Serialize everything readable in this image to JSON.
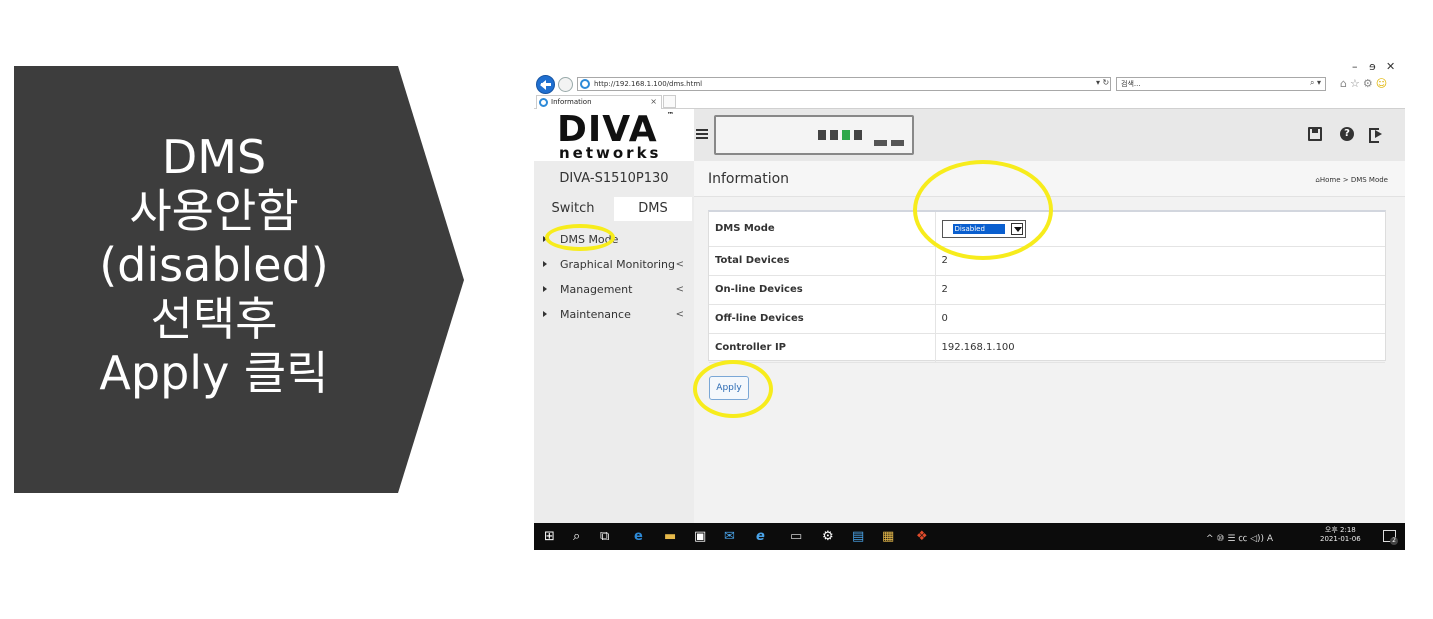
{
  "callout": {
    "lines": [
      "DMS",
      "사용안함",
      "(disabled)",
      "선택후",
      "Apply 클릭"
    ]
  },
  "browser": {
    "url": "http://192.168.1.100/dms.html",
    "search_placeholder": "검색...",
    "tab_title": "Information",
    "tab_close": "×"
  },
  "app": {
    "logo_text": "DIVA",
    "logo_tm": "™",
    "logo_sub": "networks",
    "model": "DIVA-S1510P130",
    "tabs": [
      "Switch",
      "DMS"
    ],
    "menu": [
      {
        "label": "DMS Mode",
        "chevron": ""
      },
      {
        "label": "Graphical Monitoring",
        "chevron": "<"
      },
      {
        "label": "Management",
        "chevron": "<"
      },
      {
        "label": "Maintenance",
        "chevron": "<"
      }
    ],
    "page_title": "Information",
    "breadcrumb": "Home > DMS Mode",
    "rows": [
      {
        "label": "DMS Mode",
        "value": "Disabled"
      },
      {
        "label": "Total Devices",
        "value": "2"
      },
      {
        "label": "On-line Devices",
        "value": "2"
      },
      {
        "label": "Off-line Devices",
        "value": "0"
      },
      {
        "label": "Controller IP",
        "value": "192.168.1.100"
      }
    ],
    "apply_label": "Apply"
  },
  "taskbar": {
    "tray_text": "^ ⑩ ☰ ㏄ ◁)) A",
    "time": "오후 2:18",
    "date": "2021-01-06",
    "notif_count": "2"
  },
  "colors": {
    "callout_bg": "#3d3d3d",
    "highlight": "#f7ec1c",
    "select_highlight": "#0a5fcf"
  }
}
